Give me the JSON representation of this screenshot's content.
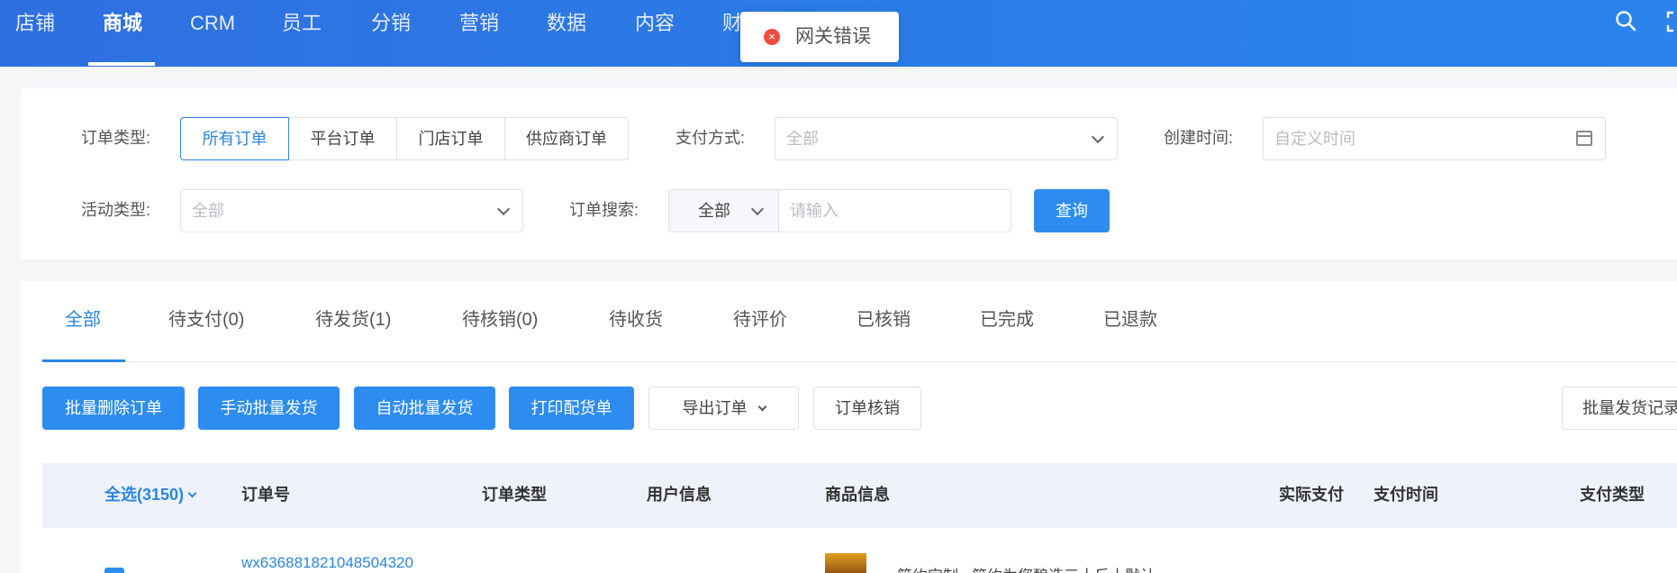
{
  "nav": {
    "items": [
      {
        "label": "店铺"
      },
      {
        "label": "商城"
      },
      {
        "label": "CRM"
      },
      {
        "label": "员工"
      },
      {
        "label": "分销"
      },
      {
        "label": "营销"
      },
      {
        "label": "数据"
      },
      {
        "label": "内容"
      },
      {
        "label": "财"
      }
    ],
    "active_index": 1
  },
  "toast": {
    "message": "网关错误"
  },
  "filters": {
    "order_type_label": "订单类型:",
    "order_types": [
      "所有订单",
      "平台订单",
      "门店订单",
      "供应商订单"
    ],
    "payment_label": "支付方式:",
    "payment_placeholder": "全部",
    "created_label": "创建时间:",
    "created_placeholder": "自定义时间",
    "activity_label": "活动类型:",
    "activity_placeholder": "全部",
    "search_label": "订单搜索:",
    "search_scope": "全部",
    "search_placeholder": "请输入",
    "query_button": "查询"
  },
  "tabs": [
    "全部",
    "待支付(0)",
    "待发货(1)",
    "待核销(0)",
    "待收货",
    "待评价",
    "已核销",
    "已完成",
    "已退款"
  ],
  "actions": {
    "batch_delete": "批量删除订单",
    "manual_ship": "手动批量发货",
    "auto_ship": "自动批量发货",
    "print": "打印配货单",
    "export": "导出订单",
    "verify": "订单核销",
    "ship_record": "批量发货记录"
  },
  "table": {
    "select_all": "全选(3150)",
    "columns": [
      "订单号",
      "订单类型",
      "用户信息",
      "商品信息",
      "实际支付",
      "支付时间",
      "支付类型"
    ],
    "first_row": {
      "order_no": "wx636881821048504320",
      "product": "简约定制 - 简约为您酿造三十斤土默认"
    }
  },
  "colors": {
    "primary": "#2d8cf0",
    "nav_bg": "#2f6fe0",
    "error": "#f04c3e"
  }
}
